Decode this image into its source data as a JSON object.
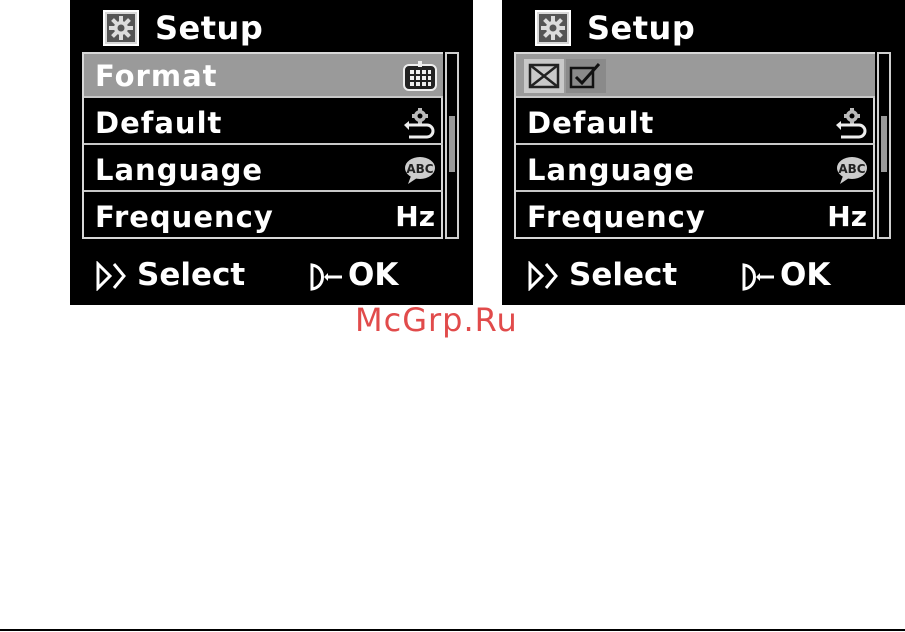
{
  "screens": [
    {
      "title": "Setup",
      "header_icon": "gear-icon",
      "menu": [
        {
          "label": "Format",
          "icon": "format-grid-icon",
          "selected": true
        },
        {
          "label": "Default",
          "icon": "default-reset-icon",
          "selected": false
        },
        {
          "label": "Language",
          "icon": "abc-bubble-icon",
          "selected": false
        },
        {
          "label": "Frequency",
          "icon_text": "Hz",
          "selected": false
        }
      ],
      "footer": {
        "select_label": "Select",
        "ok_label": "OK"
      }
    },
    {
      "title": "Setup",
      "header_icon": "gear-icon",
      "menu": [
        {
          "label": "",
          "icon": "confirm-no-yes-icons",
          "selected": true
        },
        {
          "label": "Default",
          "icon": "default-reset-icon",
          "selected": false
        },
        {
          "label": "Language",
          "icon": "abc-bubble-icon",
          "selected": false
        },
        {
          "label": "Frequency",
          "icon_text": "Hz",
          "selected": false
        }
      ],
      "footer": {
        "select_label": "Select",
        "ok_label": "OK"
      }
    }
  ],
  "watermark": "McGrp.Ru",
  "colors": {
    "screen_bg": "#000000",
    "selected_row": "#9a9a9a",
    "watermark": "#e14b4b"
  }
}
